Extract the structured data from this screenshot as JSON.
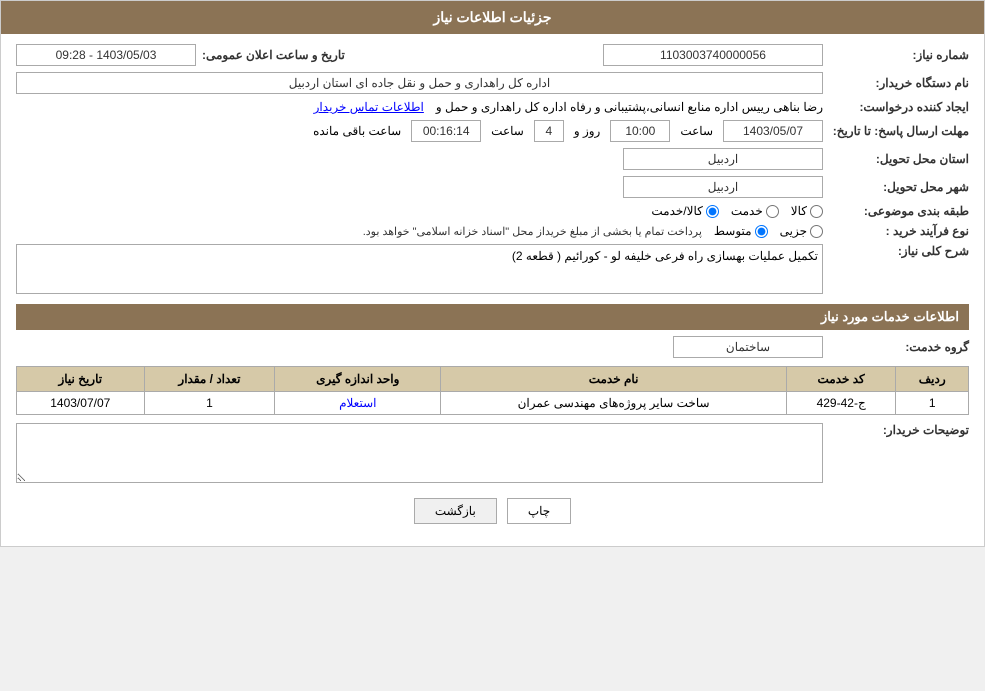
{
  "header": {
    "title": "جزئیات اطلاعات نیاز"
  },
  "fields": {
    "need_number_label": "شماره نیاز:",
    "need_number_value": "1103003740000056",
    "buyer_org_label": "نام دستگاه خریدار:",
    "buyer_org_value": "اداره کل راهداری و حمل و نقل جاده ای استان اردبیل",
    "requester_label": "ایجاد کننده درخواست:",
    "requester_value": "رضا بناهی رییس اداره منابع انسانی،پشتیبانی و رفاه اداره کل راهداری و حمل و",
    "requester_link": "اطلاعات تماس خریدار",
    "response_deadline_label": "مهلت ارسال پاسخ: تا تاریخ:",
    "announcement_datetime_label": "تاریخ و ساعت اعلان عمومی:",
    "announcement_date": "1403/05/03 - 09:28",
    "response_date": "1403/05/07",
    "response_time": "10:00",
    "response_days": "4",
    "remaining_time": "00:16:14",
    "province_label": "استان محل تحویل:",
    "province_value": "اردبیل",
    "city_label": "شهر محل تحویل:",
    "city_value": "اردبیل",
    "category_label": "طبقه بندی موضوعی:",
    "category_kala": "کالا",
    "category_khedmat": "خدمت",
    "category_kala_khedmat": "کالا/خدمت",
    "process_label": "نوع فرآیند خرید :",
    "process_jozvi": "جزیی",
    "process_mutavasset": "متوسط",
    "process_note": "پرداخت تمام یا بخشی از مبلغ خریداز محل \"اسناد خزانه اسلامی\" خواهد بود.",
    "need_description_label": "شرح کلی نیاز:",
    "need_description_value": "تکمیل عملیات بهسازی راه فرعی خلیفه لو - کورائیم ( قطعه 2)",
    "services_section_label": "اطلاعات خدمات مورد نیاز",
    "group_service_label": "گروه خدمت:",
    "group_service_value": "ساختمان",
    "table": {
      "headers": [
        "ردیف",
        "کد خدمت",
        "نام خدمت",
        "واحد اندازه گیری",
        "تعداد / مقدار",
        "تاریخ نیاز"
      ],
      "rows": [
        {
          "row": "1",
          "service_code": "ج-42-429",
          "service_name": "ساخت سایر پروژه‌های مهندسی عمران",
          "unit": "استعلام",
          "quantity": "1",
          "date": "1403/07/07"
        }
      ]
    },
    "buyer_desc_label": "توضیحات خریدار:",
    "buyer_desc_value": ""
  },
  "buttons": {
    "print": "چاپ",
    "back": "بازگشت"
  },
  "labels": {
    "days": "روز و",
    "time_remaining": "ساعت باقی مانده"
  }
}
